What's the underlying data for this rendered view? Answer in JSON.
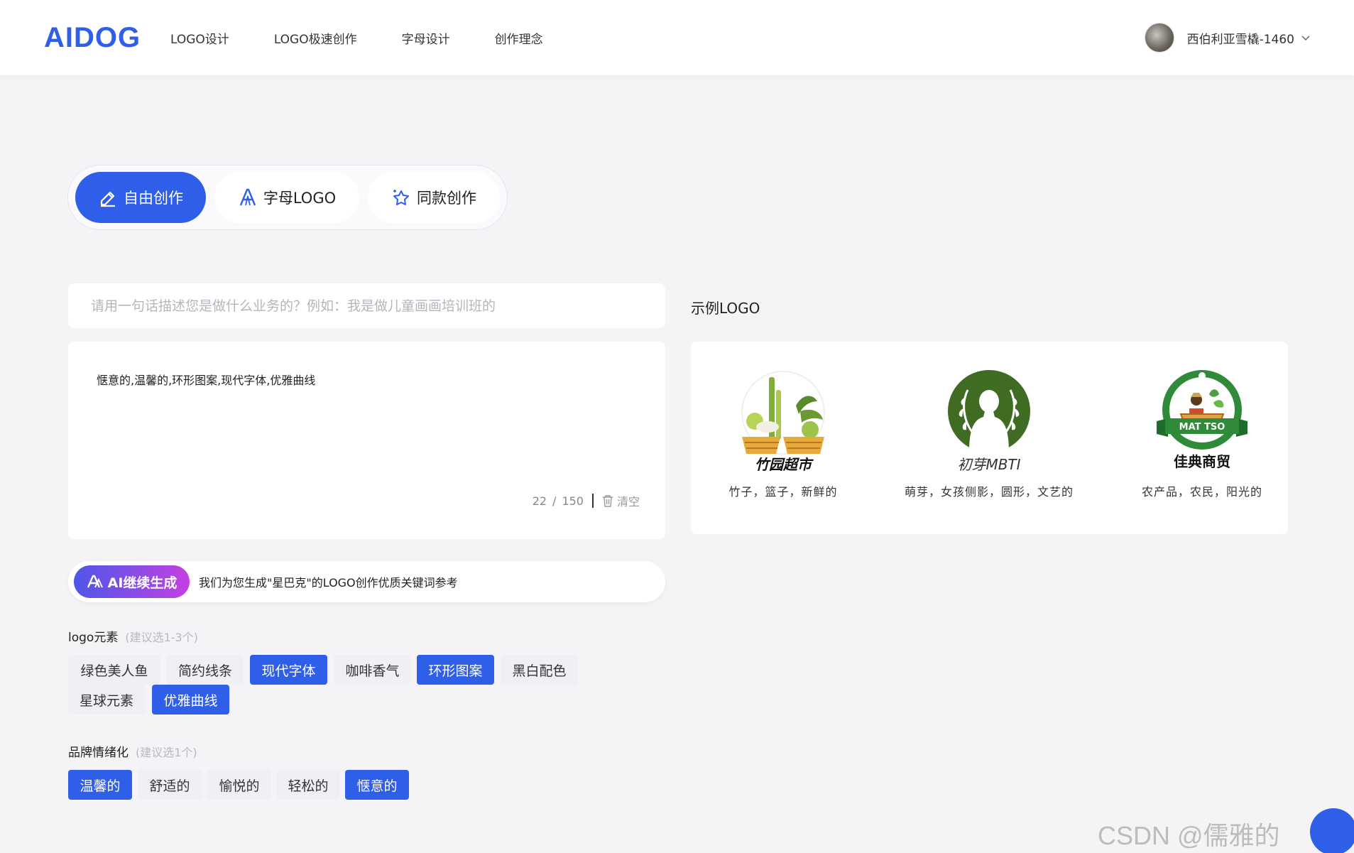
{
  "header": {
    "logo_text": "AIDOG",
    "nav": [
      "LOGO设计",
      "LOGO极速创作",
      "字母设计",
      "创作理念"
    ],
    "username": "西伯利亚雪橇-1460"
  },
  "mode_tabs": [
    "自由创作",
    "字母LOGO",
    "同款创作"
  ],
  "description_placeholder": "请用一句话描述您是做什么业务的？例如：我是做儿童画画培训班的",
  "keywords": {
    "text": "惬意的,温馨的,环形图案,现代字体,优雅曲线",
    "count": "22",
    "divider": "/",
    "max": "150",
    "clear_label": "清空"
  },
  "ai": {
    "button_label": "AI继续生成",
    "hint": "我们为您生成\"星巴克\"的LOGO创作优质关键词参考"
  },
  "logo_elements": {
    "label": "logo元素",
    "hint": "(建议选1-3个)",
    "tags": [
      {
        "label": "绿色美人鱼",
        "selected": false
      },
      {
        "label": "简约线条",
        "selected": false
      },
      {
        "label": "现代字体",
        "selected": true
      },
      {
        "label": "咖啡香气",
        "selected": false
      },
      {
        "label": "环形图案",
        "selected": true
      },
      {
        "label": "黑白配色",
        "selected": false
      },
      {
        "label": "星球元素",
        "selected": false
      },
      {
        "label": "优雅曲线",
        "selected": true
      }
    ]
  },
  "brand_emotion": {
    "label": "品牌情绪化",
    "hint": "(建议选1个)",
    "tags": [
      {
        "label": "温馨的",
        "selected": true
      },
      {
        "label": "舒适的",
        "selected": false
      },
      {
        "label": "愉悦的",
        "selected": false
      },
      {
        "label": "轻松的",
        "selected": false
      },
      {
        "label": "惬意的",
        "selected": true
      }
    ]
  },
  "examples": {
    "title": "示例LOGO",
    "items": [
      {
        "name": "竹园超市",
        "caption": "竹子，篮子，新鲜的"
      },
      {
        "name": "初芽MBTI",
        "caption": "萌芽，女孩侧影，圆形，文艺的"
      },
      {
        "name": "佳典商贸",
        "badge": "MAT TSO",
        "caption": "农产品，农民，阳光的"
      }
    ]
  },
  "watermark": "CSDN @儒雅的AIDOG",
  "colors": {
    "primary": "#2f5ee8",
    "page_bg": "#f4f4f6",
    "tag_bg": "#eef0f3",
    "ai_gradient_start": "#4f56e8",
    "ai_gradient_end": "#c63fe2"
  }
}
